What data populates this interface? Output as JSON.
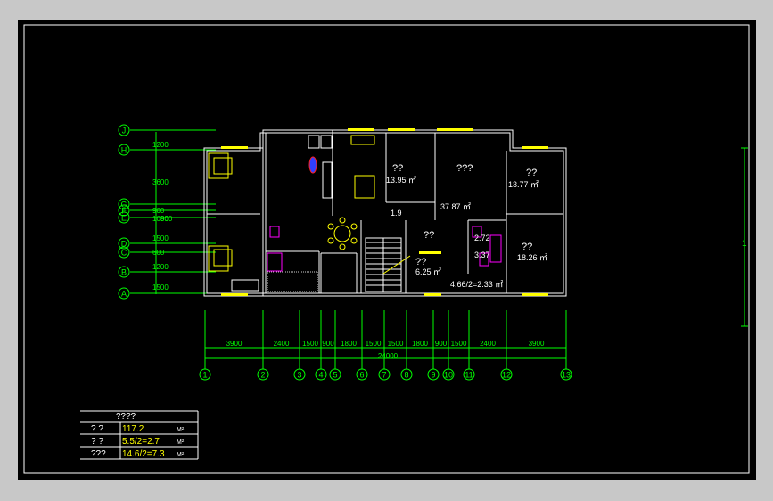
{
  "rooms": [
    {
      "name": "??",
      "area": "13.95 ㎡"
    },
    {
      "name": "???",
      "area": "37.87 ㎡"
    },
    {
      "name": "??",
      "area": "13.77 ㎡"
    },
    {
      "name": "??",
      "area": "18.26 ㎡"
    },
    {
      "name": "??",
      "area": "6.25 ㎡"
    },
    {
      "name": "??",
      "area": ""
    }
  ],
  "annotations": [
    "1.9",
    "2.72",
    "3.37",
    "4.66/2=2.33 ㎡"
  ],
  "row_axes": [
    "J",
    "H",
    "G",
    "F",
    "E",
    "D",
    "C",
    "B",
    "A"
  ],
  "row_dims": [
    "1200",
    "3600",
    "900",
    "1080",
    "1500",
    "600",
    "1200",
    "1500"
  ],
  "row_overlap": "900",
  "col_axes": [
    "1",
    "2",
    "3",
    "4",
    "5",
    "6",
    "7",
    "8",
    "9",
    "10",
    "11",
    "12",
    "13"
  ],
  "col_dims": [
    "3900",
    "2400",
    "1500",
    "900",
    "1800",
    "1500",
    "1500",
    "1800",
    "900",
    "1500",
    "2400",
    "3900"
  ],
  "total_width": "24000",
  "right_mark": "1",
  "table": {
    "title": "????",
    "rows": [
      {
        "label": "?  ?",
        "value": "117.2",
        "unit": "M²"
      },
      {
        "label": "?  ?",
        "value": "5.5/2=2.7",
        "unit": "M²"
      },
      {
        "label": "???",
        "value": "14.6/2=7.3",
        "unit": "M²"
      }
    ]
  },
  "colors": {
    "background": "#000000",
    "walls": "#ffffff",
    "dims": "#00ff00",
    "fixtures": "#ffff00",
    "sanitary": "#ff00ff"
  }
}
